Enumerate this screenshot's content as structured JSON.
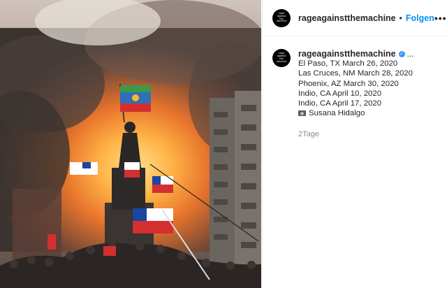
{
  "post": {
    "username": "rageagainstthemachine",
    "separator": "•",
    "follow_label": "Folgen",
    "more_icon": "more-horizontal-icon",
    "avatar_text": "rage\nagainst\nthe\nmachine"
  },
  "caption": {
    "username": "rageagainstthemachine",
    "verified_icon": "verified-badge-icon",
    "ellipsis": "...",
    "lines": [
      "El Paso, TX March 26, 2020",
      "Las Cruces, NM March 28, 2020",
      "Phoenix, AZ March 30, 2020",
      "Indio, CA April 10, 2020",
      "Indio, CA April 17, 2020"
    ],
    "credit_icon": "camera-icon",
    "credit": "Susana Hidalgo"
  },
  "timestamp": "2Tage",
  "colors": {
    "accent": "#0095f6",
    "verified": "#3897f0",
    "muted": "#8e8e8e"
  }
}
